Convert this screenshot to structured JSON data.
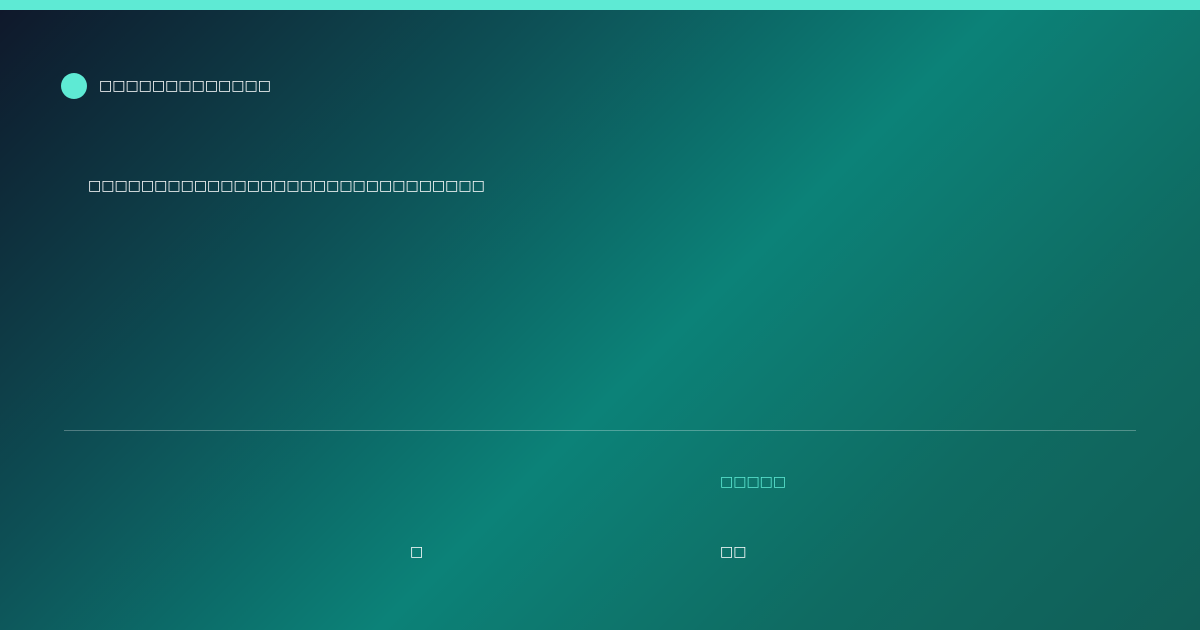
{
  "colors": {
    "accent": "#5eead4",
    "text": "#ffffff",
    "background_start": "#0f172a",
    "background_mid": "#0c8278",
    "background_end": "#115e57"
  },
  "header": {
    "brand_icon": "circle-logo-icon",
    "brand_name": "□□□□□□□□□□□□□"
  },
  "main": {
    "headline": "□□□□□□□□□□□□□□□□□□□□□□□□□□□□□□"
  },
  "footer": {
    "left_value": "□",
    "right_label": "□□□□□",
    "right_value": "□□"
  }
}
